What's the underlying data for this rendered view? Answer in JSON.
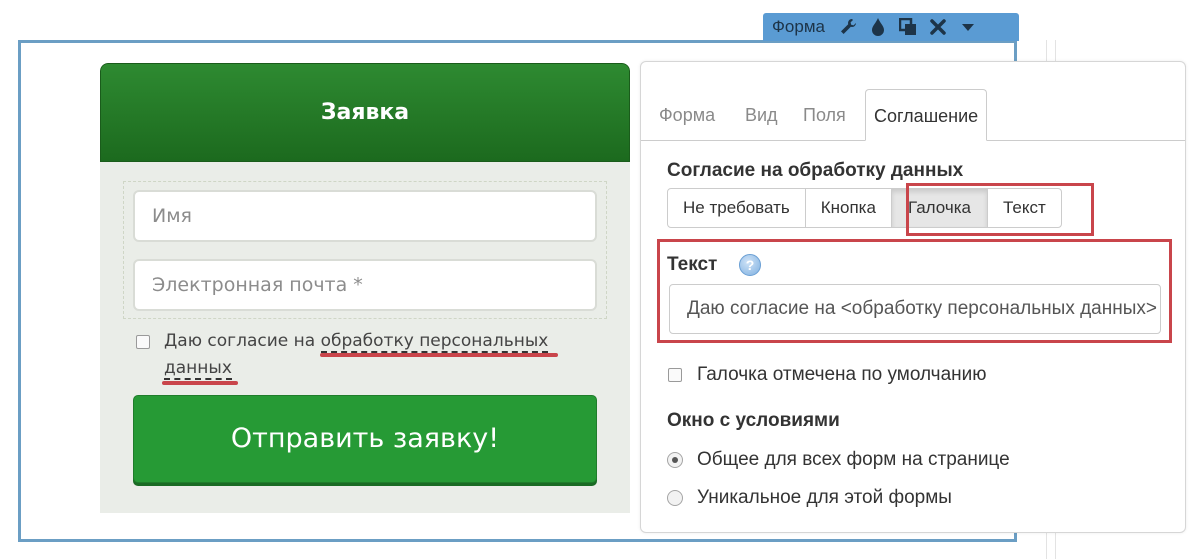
{
  "toolbar": {
    "label": "Форма",
    "icons": [
      "wrench-icon",
      "drop-icon",
      "copy-icon",
      "close-icon",
      "caret-down-icon"
    ]
  },
  "form": {
    "title": "Заявка",
    "name_placeholder": "Имя",
    "email_placeholder": "Электронная почта *",
    "consent_prefix": "Даю согласие на ",
    "consent_link": "обработку персональных данных",
    "submit_label": "Отправить заявку!"
  },
  "panel": {
    "tabs": [
      {
        "label": "Форма",
        "active": false
      },
      {
        "label": "Вид",
        "active": false
      },
      {
        "label": "Поля",
        "active": false
      },
      {
        "label": "Соглашение",
        "active": true
      }
    ],
    "consent_heading": "Согласие на обработку данных",
    "consent_modes": [
      {
        "label": "Не требовать",
        "active": false
      },
      {
        "label": "Кнопка",
        "active": false
      },
      {
        "label": "Галочка",
        "active": true
      },
      {
        "label": "Текст",
        "active": false
      }
    ],
    "text_label": "Текст",
    "text_value": "Даю согласие на <обработку персональных данных>",
    "default_checked_label": "Галочка отмечена по умолчанию",
    "default_checked": false,
    "terms_window_heading": "Окно с условиями",
    "terms_options": [
      {
        "label": "Общее для всех форм на странице",
        "checked": true
      },
      {
        "label": "Уникальное для этой формы",
        "checked": false
      }
    ]
  },
  "colors": {
    "frame": "#6b9ec4",
    "toolbar": "#5a9bd3",
    "form_header": "#1c6a1e",
    "submit": "#269a35",
    "highlight": "#c9454b"
  }
}
